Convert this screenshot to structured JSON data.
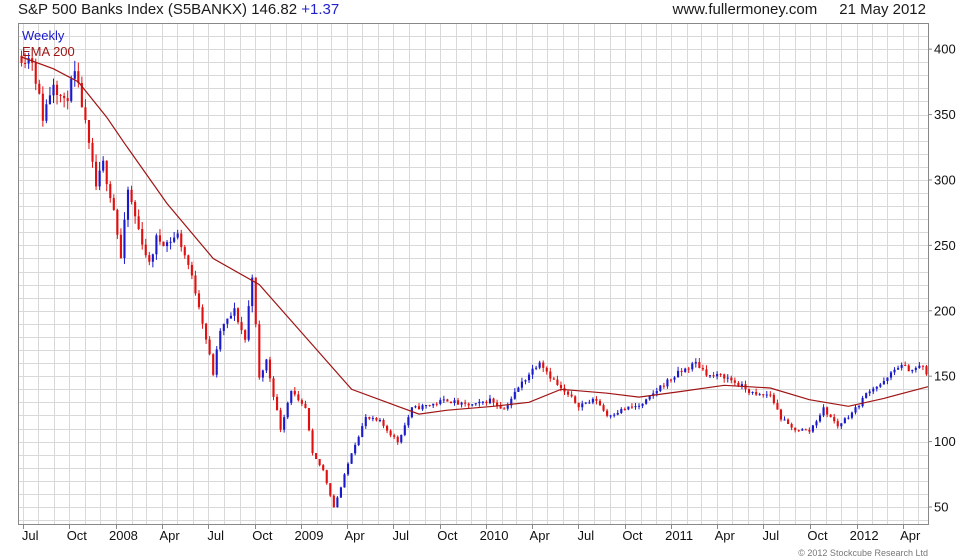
{
  "header": {
    "title": "S&P 500 Banks Index (S5BANKX)",
    "price": "146.82",
    "change": "+1.37",
    "website": "www.fullermoney.com",
    "date": "21 May 2012"
  },
  "copyright": "© 2012 Stockcube Research Ltd",
  "colors": {
    "up": "#1a1acc",
    "down": "#e01010",
    "ema": "#a01414",
    "grid": "#d9d9d9",
    "frame": "#888888"
  },
  "chart_data": {
    "type": "candlestick",
    "legend": [
      {
        "label": "Weekly",
        "color": "#1a1acc"
      },
      {
        "label": "EMA 200",
        "color": "#a01414"
      }
    ],
    "x_ticks": [
      "Jul",
      "Oct",
      "2008",
      "Apr",
      "Jul",
      "Oct",
      "2009",
      "Apr",
      "Jul",
      "Oct",
      "2010",
      "Apr",
      "Jul",
      "Oct",
      "2011",
      "Apr",
      "Jul",
      "Oct",
      "2012",
      "Apr"
    ],
    "y_ticks": [
      50,
      100,
      150,
      200,
      250,
      300,
      350,
      400
    ],
    "ylim": [
      37,
      420
    ],
    "x_range": [
      "2007-06-22",
      "2012-05-21"
    ],
    "grid": true,
    "close_path": [
      [
        "2007-06-29",
        395
      ],
      [
        "2007-07-20",
        392
      ],
      [
        "2007-08-10",
        348
      ],
      [
        "2007-08-31",
        376
      ],
      [
        "2007-09-21",
        358
      ],
      [
        "2007-10-12",
        380
      ],
      [
        "2007-10-26",
        358
      ],
      [
        "2007-11-09",
        325
      ],
      [
        "2007-11-23",
        295
      ],
      [
        "2007-12-07",
        312
      ],
      [
        "2007-12-28",
        278
      ],
      [
        "2008-01-11",
        240
      ],
      [
        "2008-01-25",
        292
      ],
      [
        "2008-02-15",
        262
      ],
      [
        "2008-03-07",
        235
      ],
      [
        "2008-03-21",
        255
      ],
      [
        "2008-04-11",
        252
      ],
      [
        "2008-05-02",
        258
      ],
      [
        "2008-05-23",
        235
      ],
      [
        "2008-06-13",
        205
      ],
      [
        "2008-07-11",
        152
      ],
      [
        "2008-07-25",
        185
      ],
      [
        "2008-08-22",
        200
      ],
      [
        "2008-09-12",
        178
      ],
      [
        "2008-09-26",
        228
      ],
      [
        "2008-10-10",
        148
      ],
      [
        "2008-10-24",
        162
      ],
      [
        "2008-11-21",
        110
      ],
      [
        "2008-12-12",
        140
      ],
      [
        "2008-12-26",
        130
      ],
      [
        "2009-01-09",
        125
      ],
      [
        "2009-01-23",
        90
      ],
      [
        "2009-02-13",
        78
      ],
      [
        "2009-03-06",
        50
      ],
      [
        "2009-03-20",
        65
      ],
      [
        "2009-04-10",
        92
      ],
      [
        "2009-05-08",
        118
      ],
      [
        "2009-06-05",
        115
      ],
      [
        "2009-07-10",
        100
      ],
      [
        "2009-08-07",
        125
      ],
      [
        "2009-09-11",
        128
      ],
      [
        "2009-10-16",
        132
      ],
      [
        "2009-11-13",
        128
      ],
      [
        "2009-12-11",
        128
      ],
      [
        "2010-01-08",
        132
      ],
      [
        "2010-02-05",
        125
      ],
      [
        "2010-03-12",
        145
      ],
      [
        "2010-04-16",
        162
      ],
      [
        "2010-05-07",
        150
      ],
      [
        "2010-05-28",
        140
      ],
      [
        "2010-07-02",
        128
      ],
      [
        "2010-08-06",
        132
      ],
      [
        "2010-08-27",
        120
      ],
      [
        "2010-10-01",
        125
      ],
      [
        "2010-11-05",
        128
      ],
      [
        "2010-12-10",
        142
      ],
      [
        "2011-01-14",
        152
      ],
      [
        "2011-02-18",
        160
      ],
      [
        "2011-03-18",
        150
      ],
      [
        "2011-04-15",
        150
      ],
      [
        "2011-05-20",
        142
      ],
      [
        "2011-06-17",
        135
      ],
      [
        "2011-07-15",
        136
      ],
      [
        "2011-08-05",
        118
      ],
      [
        "2011-08-26",
        110
      ],
      [
        "2011-09-30",
        108
      ],
      [
        "2011-10-28",
        125
      ],
      [
        "2011-11-25",
        112
      ],
      [
        "2011-12-30",
        125
      ],
      [
        "2012-01-27",
        140
      ],
      [
        "2012-02-24",
        145
      ],
      [
        "2012-03-23",
        158
      ],
      [
        "2012-04-20",
        155
      ],
      [
        "2012-05-11",
        158
      ],
      [
        "2012-05-21",
        146.82
      ]
    ],
    "ema_200": [
      [
        "2007-06-29",
        394
      ],
      [
        "2007-08-31",
        385
      ],
      [
        "2007-10-19",
        375
      ],
      [
        "2007-12-14",
        348
      ],
      [
        "2008-01-18",
        328
      ],
      [
        "2008-04-11",
        282
      ],
      [
        "2008-07-11",
        240
      ],
      [
        "2008-10-10",
        220
      ],
      [
        "2009-01-09",
        180
      ],
      [
        "2009-04-10",
        140
      ],
      [
        "2009-07-10",
        127
      ],
      [
        "2009-08-21",
        121
      ],
      [
        "2009-10-16",
        124
      ],
      [
        "2010-01-15",
        127
      ],
      [
        "2010-03-26",
        130
      ],
      [
        "2010-05-28",
        140
      ],
      [
        "2010-08-27",
        137
      ],
      [
        "2010-10-29",
        134
      ],
      [
        "2011-01-14",
        138
      ],
      [
        "2011-04-15",
        143
      ],
      [
        "2011-07-15",
        141
      ],
      [
        "2011-09-30",
        132
      ],
      [
        "2011-12-16",
        127
      ],
      [
        "2012-02-24",
        133
      ],
      [
        "2012-05-21",
        142
      ]
    ]
  }
}
